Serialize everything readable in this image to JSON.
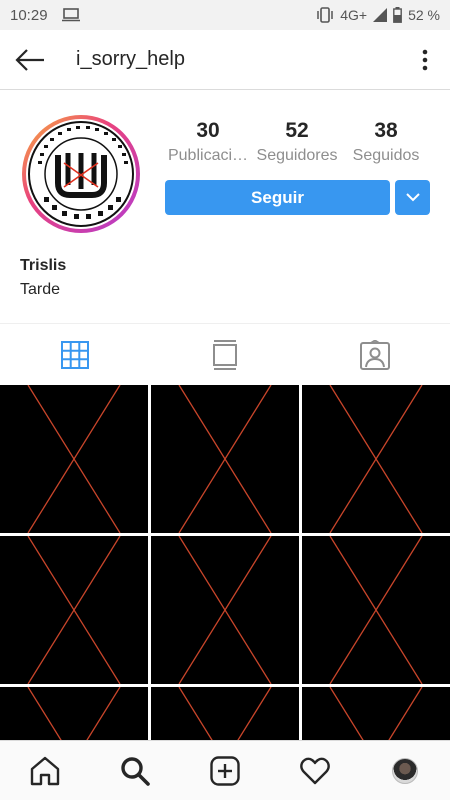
{
  "status_bar": {
    "time": "10:29",
    "network": "4G+",
    "battery": "52 %"
  },
  "header": {
    "username": "i_sorry_help"
  },
  "profile": {
    "avatar_alt": "LIGA MEXICANO IMPONES, S.C. logo",
    "stats": [
      {
        "value": "30",
        "label": "Publicaci…"
      },
      {
        "value": "52",
        "label": "Seguidores"
      },
      {
        "value": "38",
        "label": "Seguidos"
      }
    ],
    "follow_label": "Seguir",
    "display_name": "Trislis",
    "bio": "Tarde"
  },
  "tabs": [
    "grid-icon",
    "feed-icon",
    "tagged-icon"
  ],
  "grid": {
    "cells": 9,
    "cell_color": "#000000",
    "cross_color": "#c8452a"
  },
  "bottom_nav": [
    "home-icon",
    "search-icon",
    "add-icon",
    "heart-icon",
    "profile-avatar"
  ],
  "colors": {
    "accent": "#3897f0",
    "tab_active": "#3897f0"
  }
}
